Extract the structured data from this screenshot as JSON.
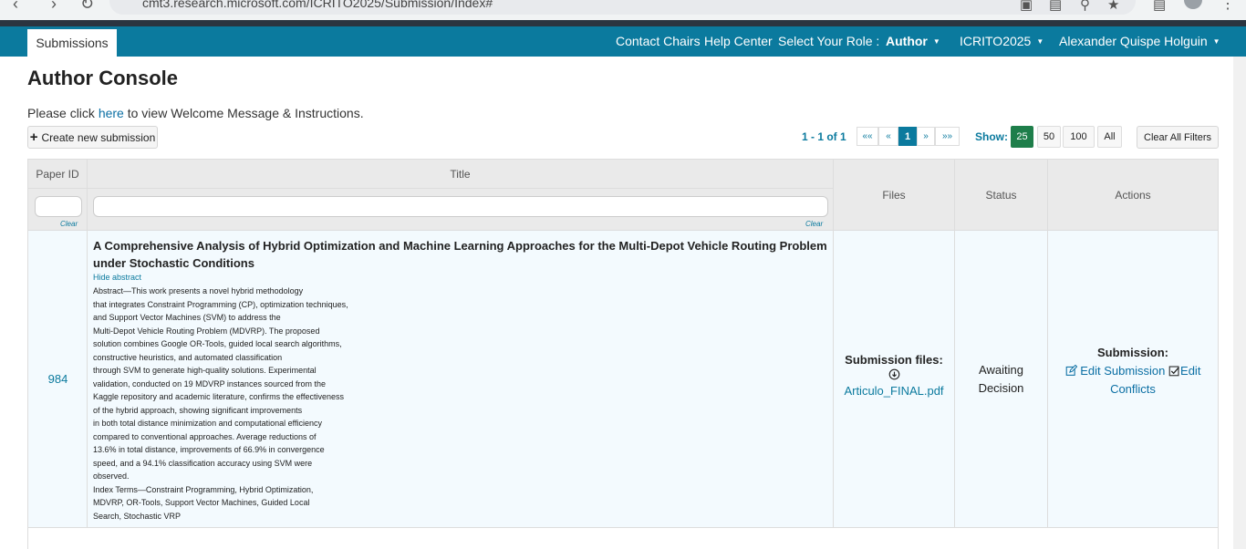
{
  "browser": {
    "url": "cmt3.research.microsoft.com/ICRITO2025/Submission/Index#"
  },
  "navbar": {
    "active_tab": "Submissions",
    "contact_chairs": "Contact Chairs",
    "help_center": "Help Center",
    "select_role_label": "Select Your Role :",
    "role": "Author",
    "conference": "ICRITO2025",
    "user": "Alexander Quispe Holguin"
  },
  "page": {
    "title": "Author Console",
    "welcome_prefix": "Please click",
    "welcome_link": "here",
    "welcome_suffix": "to view Welcome Message & Instructions.",
    "create_button": "Create new submission"
  },
  "pagination": {
    "info": "1 - 1 of 1",
    "first": "««",
    "prev": "«",
    "current": "1",
    "next": "»",
    "last": "»»",
    "show_label": "Show:",
    "sizes": [
      "25",
      "50",
      "100",
      "All"
    ],
    "active_size": "25",
    "clear_filters": "Clear All Filters"
  },
  "table": {
    "headers": {
      "paper_id": "Paper ID",
      "title": "Title",
      "files": "Files",
      "status": "Status",
      "actions": "Actions"
    },
    "clear_label": "Clear",
    "rows": [
      {
        "paper_id": "984",
        "title": "A Comprehensive Analysis of Hybrid Optimization and Machine Learning Approaches for the Multi-Depot Vehicle Routing Problem under Stochastic Conditions",
        "hide_abstract": "Hide abstract",
        "abstract_lines": [
          "Abstract—This work presents a novel hybrid methodology",
          "that integrates Constraint Programming (CP), optimization techniques,",
          "and Support Vector Machines (SVM) to address the",
          "Multi-Depot Vehicle Routing Problem (MDVRP). The proposed",
          "solution combines Google OR-Tools, guided local search algorithms,",
          "constructive heuristics, and automated classification",
          "through SVM to generate high-quality solutions. Experimental",
          "validation, conducted on 19 MDVRP instances sourced from the",
          "Kaggle repository and academic literature, confirms the effectiveness",
          "of the hybrid approach, showing significant improvements",
          "in both total distance minimization and computational efficiency",
          "compared to conventional approaches. Average reductions of",
          "13.6% in total distance, improvements of 66.9% in convergence",
          "speed, and a 94.1% classification accuracy using SVM were",
          "observed.",
          "Index Terms—Constraint Programming, Hybrid Optimization,",
          "MDVRP, OR-Tools, Support Vector Machines, Guided Local",
          "Search, Stochastic VRP"
        ],
        "files_label": "Submission files:",
        "file_name": "Articulo_FINAL.pdf",
        "status_line1": "Awaiting",
        "status_line2": "Decision",
        "actions_label": "Submission:",
        "edit_submission": "Edit Submission",
        "edit_conflicts_1": "Edit",
        "edit_conflicts_2": "Conflicts"
      }
    ]
  },
  "colors": {
    "navbar": "#0b7a9e",
    "link": "#0b6fa4",
    "show_active": "#1e7e4a",
    "row_bg": "#f3fafe"
  },
  "icons": [
    "back-icon",
    "forward-icon",
    "reload-icon",
    "plus-icon",
    "download-icon",
    "edit-icon",
    "check-square-icon",
    "caret-down-icon"
  ]
}
